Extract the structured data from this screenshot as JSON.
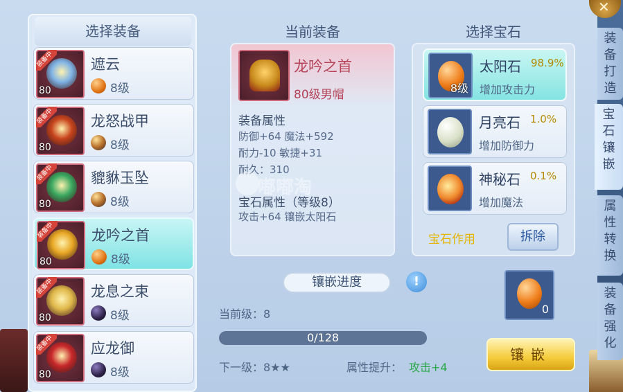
{
  "left_panel": {
    "title": "选择装备",
    "equip_badge": "装备中",
    "items": [
      {
        "name": "遮云",
        "level": "80",
        "gem_level": "8级",
        "gem": "sun",
        "glyph_color": "#7fb3e6",
        "selected": false
      },
      {
        "name": "龙怒战甲",
        "level": "80",
        "gem_level": "8级",
        "gem": "mixed",
        "glyph_color": "#c8441c",
        "selected": false
      },
      {
        "name": "貔貅玉坠",
        "level": "80",
        "gem_level": "8级",
        "gem": "mixed",
        "glyph_color": "#3aa860",
        "selected": false
      },
      {
        "name": "龙吟之首",
        "level": "80",
        "gem_level": "8级",
        "gem": "sun",
        "glyph_color": "#e8a724",
        "selected": true
      },
      {
        "name": "龙息之束",
        "level": "80",
        "gem_level": "8级",
        "gem": "dark",
        "glyph_color": "#e0b84a",
        "selected": false
      },
      {
        "name": "应龙御",
        "level": "80",
        "gem_level": "8级",
        "gem": "dark",
        "glyph_color": "#c8282a",
        "selected": false
      }
    ]
  },
  "current": {
    "title": "当前装备",
    "name": "龙吟之首",
    "subtitle": "80级男帽",
    "attr_title": "装备属性",
    "attr_lines": [
      "防御+64 魔法+592",
      "耐力-10 敏捷+31",
      "耐久：310"
    ],
    "gem_attr_title": "宝石属性（等级8）",
    "gem_attr_line": "攻击+64 镶嵌太阳石"
  },
  "watermark": "嘟嘟淘",
  "progress": {
    "label": "镶嵌进度",
    "info_icon": "!",
    "current_level": "当前级：8",
    "value_text": "0/128",
    "fraction": 0,
    "next_level": "下一级：8★★",
    "bonus_label": "属性提升：",
    "bonus_value": "攻击+4"
  },
  "gems": {
    "title": "选择宝石",
    "items": [
      {
        "name": "太阳石",
        "pct": "98.9%",
        "desc": "增加攻击力",
        "level": "8级",
        "stone": "sun",
        "selected": true
      },
      {
        "name": "月亮石",
        "pct": "1.0%",
        "desc": "增加防御力",
        "level": "",
        "stone": "moon",
        "selected": false
      },
      {
        "name": "神秘石",
        "pct": "0.1%",
        "desc": "增加魔法",
        "level": "",
        "stone": "myst",
        "selected": false
      }
    ],
    "effect_label": "宝石作用",
    "remove_label": "拆除",
    "slot_count": "0",
    "inlay_label": "镶嵌"
  },
  "side_tabs": [
    {
      "label": "装备打造",
      "active": false
    },
    {
      "label": "宝石镶嵌",
      "active": true
    },
    {
      "label": "属性转换",
      "active": false
    },
    {
      "label": "装备强化",
      "active": false
    }
  ]
}
